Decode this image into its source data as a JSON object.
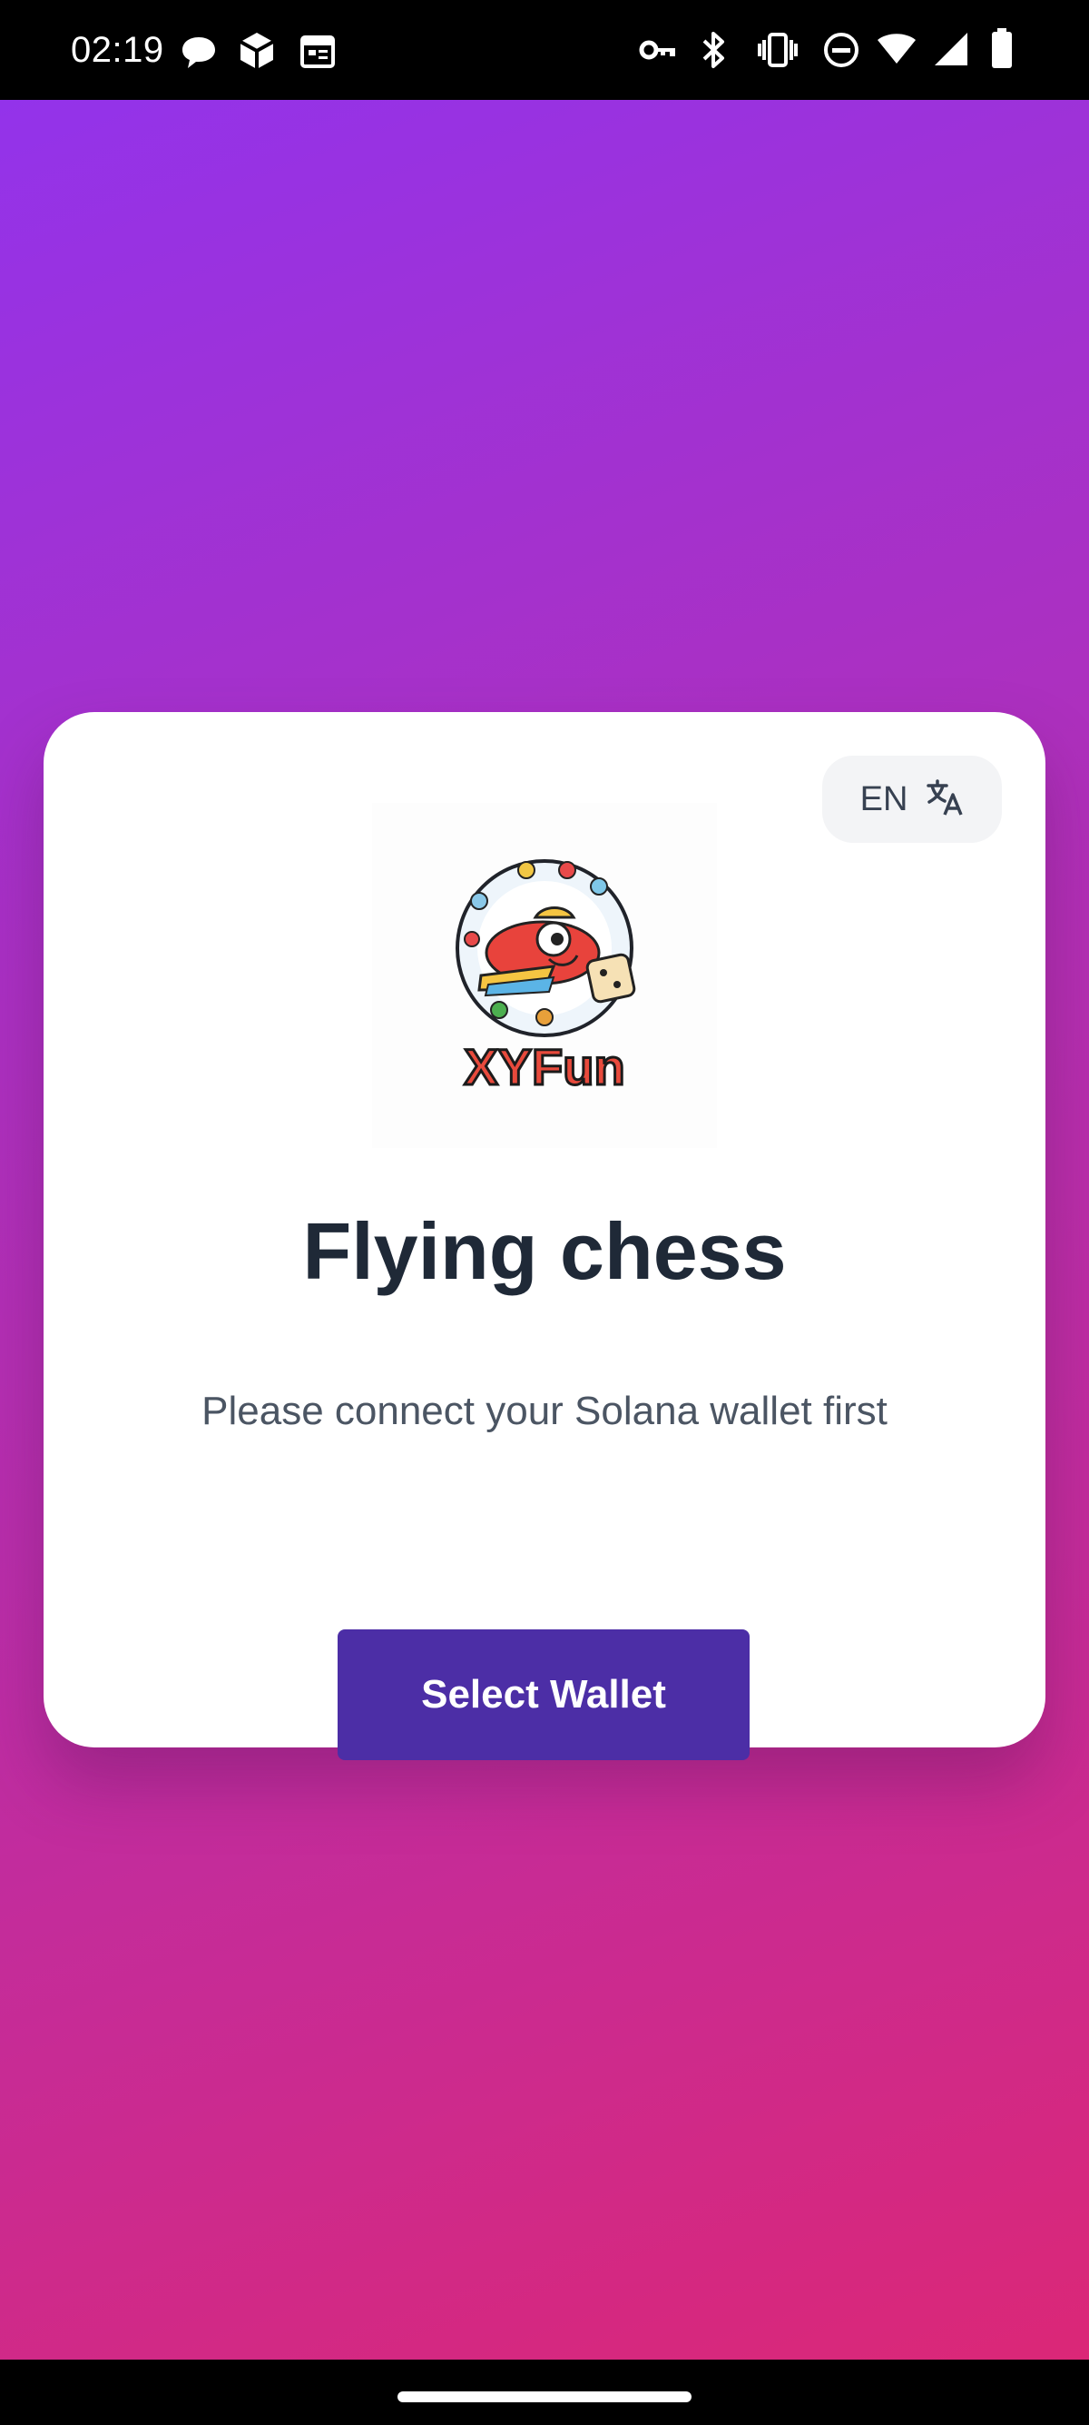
{
  "status_bar": {
    "time": "02:19",
    "left_icons": [
      "chat-bubble-icon",
      "box-icon",
      "calendar-icon"
    ],
    "right_icons": [
      "vpn-key-icon",
      "bluetooth-icon",
      "vibrate-icon",
      "do-not-disturb-icon",
      "wifi-icon",
      "signal-icon",
      "battery-icon"
    ]
  },
  "card": {
    "language_button": {
      "label": "EN",
      "icon": "translate-icon"
    },
    "logo": {
      "text": "XYFun"
    },
    "title": "Flying chess",
    "subtitle": "Please connect your Solana wallet first",
    "select_wallet_label": "Select Wallet"
  },
  "colors": {
    "gradient_start": "#9333ea",
    "gradient_end": "#db2777",
    "button": "#4c2ea6",
    "title": "#1f2937"
  }
}
